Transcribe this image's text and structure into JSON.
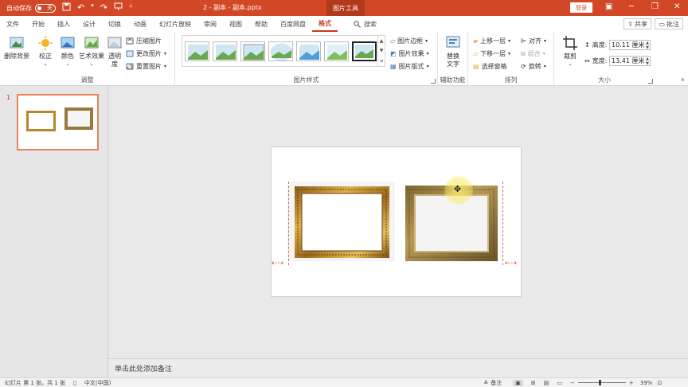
{
  "titlebar": {
    "autosave_label": "自动保存",
    "autosave_state": "关",
    "doc_title": "2 - 副本 - 副本.pptx",
    "context_tools": "图片工具",
    "login_label": "登录"
  },
  "tabs": [
    {
      "label": "文件"
    },
    {
      "label": "开始"
    },
    {
      "label": "插入"
    },
    {
      "label": "设计"
    },
    {
      "label": "切换"
    },
    {
      "label": "动画"
    },
    {
      "label": "幻灯片放映"
    },
    {
      "label": "审阅"
    },
    {
      "label": "视图"
    },
    {
      "label": "帮助"
    },
    {
      "label": "百度网盘"
    },
    {
      "label": "格式"
    }
  ],
  "search_label": "搜索",
  "share_label": "共享",
  "comment_label": "批注",
  "ribbon": {
    "remove_bg": "删除背景",
    "correct": "校正",
    "color": "颜色",
    "artistic": "艺术效果",
    "transparency_1": "透明",
    "transparency_2": "度",
    "compress": "压缩图片",
    "change": "更改图片",
    "reset": "重置图片",
    "group_adjust": "调整",
    "border": "图片边框",
    "effects": "图片效果",
    "layout": "图片版式",
    "group_styles": "图片样式",
    "alt_text_1": "替换",
    "alt_text_2": "文字",
    "group_access": "辅助功能",
    "bring_forward": "上移一层",
    "send_backward": "下移一层",
    "selection_pane": "选择窗格",
    "align": "对齐",
    "group": "组合",
    "rotate": "旋转",
    "group_arrange": "排列",
    "crop": "裁剪",
    "height_label": "高度:",
    "height_value": "10.11 厘米",
    "width_label": "宽度:",
    "width_value": "13.41 厘米",
    "group_size": "大小"
  },
  "thumbnails": {
    "slide_number": "1"
  },
  "notes_placeholder": "单击此处添加备注",
  "statusbar": {
    "slide_info": "幻灯片 第 1 张，共 1 张",
    "language": "中文(中国)",
    "notes": "备注",
    "zoom_level": "39%"
  },
  "colors": {
    "accent": "#d24726",
    "tab_active": "#c43e1c",
    "gold_frame": "#b8862b",
    "antique_frame": "#9a7a3c"
  }
}
